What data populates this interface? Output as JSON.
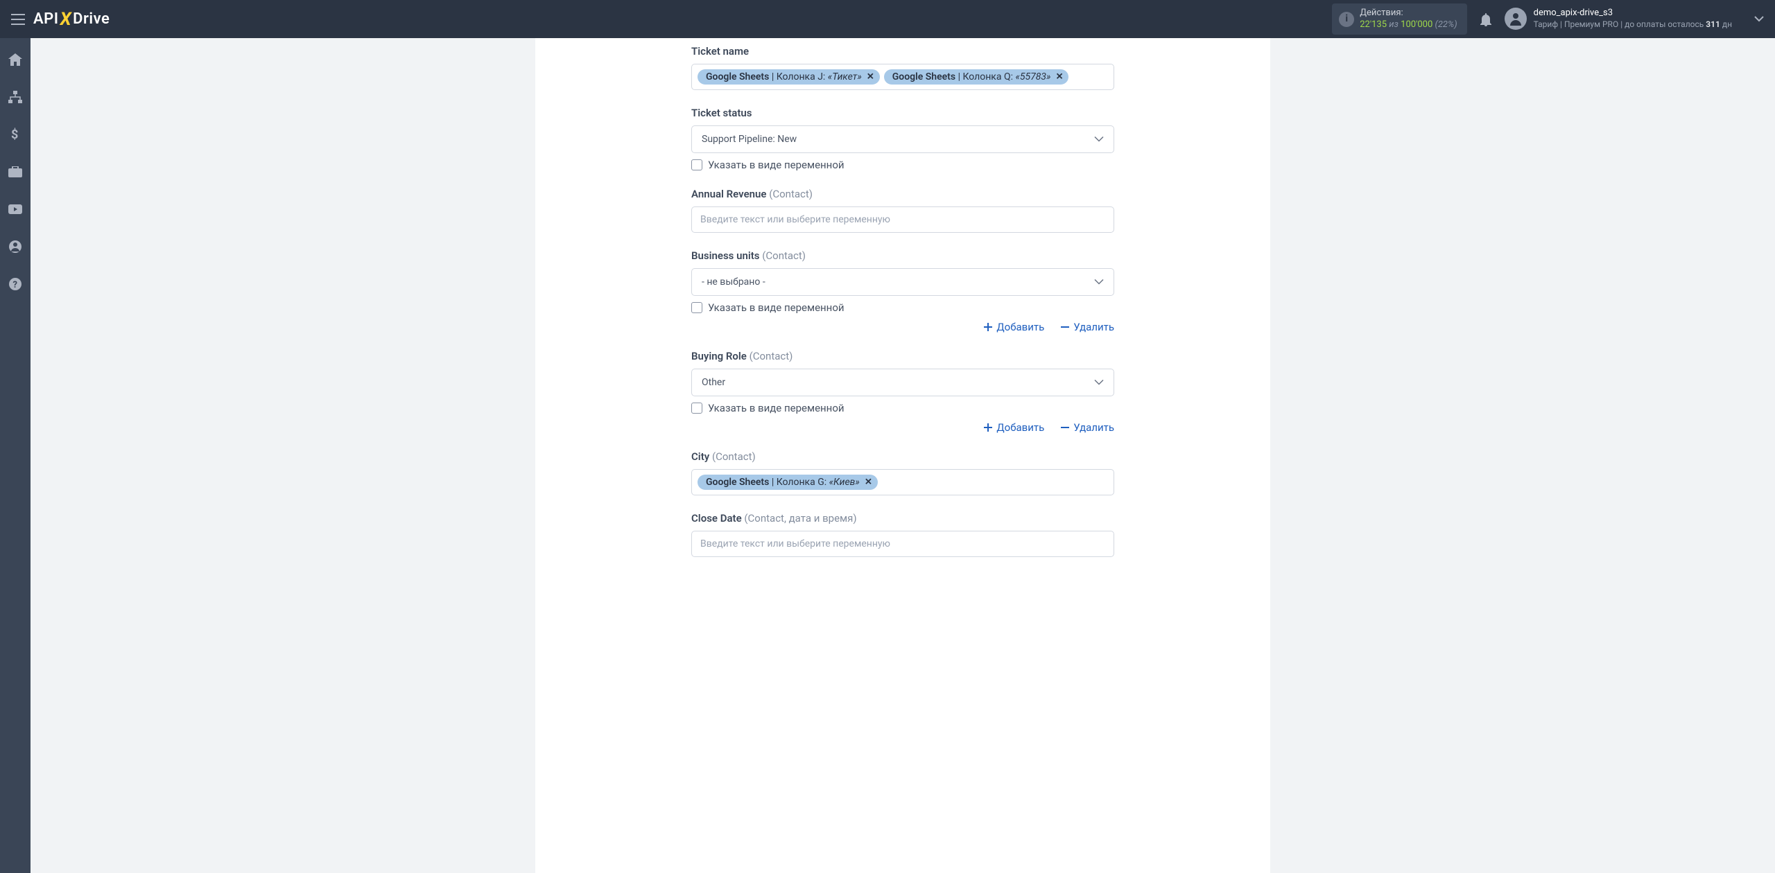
{
  "header": {
    "logo": {
      "part1": "API",
      "part2": "X",
      "part3": "Drive"
    },
    "actions": {
      "title": "Действия:",
      "current": "22'135",
      "sep": "из",
      "total": "100'000",
      "percent": "(22%)"
    },
    "user": {
      "name": "demo_apix-drive_s3",
      "tariff_label": "Тариф |",
      "tariff_name": "Премиум PRO",
      "pay_label": "|  до оплаты осталось",
      "days": "311",
      "days_suffix": "дн"
    }
  },
  "form": {
    "placeholder_text": "Введите текст или выберите переменную",
    "variable_checkbox_label": "Указать в виде переменной",
    "add_label": "Добавить",
    "delete_label": "Удалить",
    "not_selected": "- не выбрано -",
    "fields": {
      "ticket_name": {
        "label": "Ticket name",
        "tokens": [
          {
            "src": "Google Sheets",
            "col": "Колонка J:",
            "val": "«Тикет»"
          },
          {
            "src": "Google Sheets",
            "col": "Колонка Q:",
            "val": "«55783»"
          }
        ]
      },
      "ticket_status": {
        "label": "Ticket status",
        "value": "Support Pipeline: New"
      },
      "annual_revenue": {
        "label": "Annual Revenue",
        "suffix": "(Contact)"
      },
      "business_units": {
        "label": "Business units",
        "suffix": "(Contact)"
      },
      "buying_role": {
        "label": "Buying Role",
        "suffix": "(Contact)",
        "value": "Other"
      },
      "city": {
        "label": "City",
        "suffix": "(Contact)",
        "tokens": [
          {
            "src": "Google Sheets",
            "col": "Колонка G:",
            "val": "«Киев»"
          }
        ]
      },
      "close_date": {
        "label": "Close Date",
        "suffix": "(Contact, дата и время)"
      }
    }
  }
}
